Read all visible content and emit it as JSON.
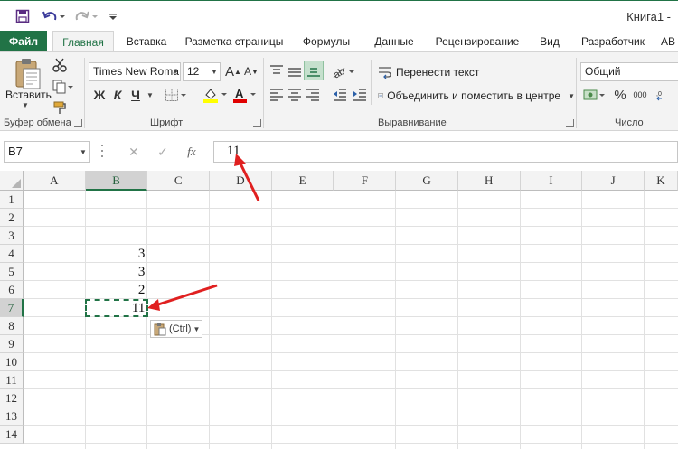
{
  "window": {
    "title": "Книга1 -"
  },
  "tabs": [
    {
      "label": "Файл"
    },
    {
      "label": "Главная"
    },
    {
      "label": "Вставка"
    },
    {
      "label": "Разметка страницы"
    },
    {
      "label": "Формулы"
    },
    {
      "label": "Данные"
    },
    {
      "label": "Рецензирование"
    },
    {
      "label": "Вид"
    },
    {
      "label": "Разработчик"
    },
    {
      "label": "AB"
    }
  ],
  "ribbon": {
    "clipboard": {
      "label": "Буфер обмена",
      "paste_label": "Вставить"
    },
    "font": {
      "label": "Шрифт",
      "name": "Times New Roma",
      "size": "12",
      "bold": "Ж",
      "italic": "К",
      "underline": "Ч",
      "grow": "A",
      "shrink": "A",
      "color_letter": "A",
      "highlight_color": "#ffff00",
      "font_color": "#e00000"
    },
    "alignment": {
      "label": "Выравнивание",
      "wrap_text": "Перенести текст",
      "merge_center": "Объединить и поместить в центре"
    },
    "number": {
      "label": "Число",
      "format": "Общий",
      "percent": "%",
      "thousands": "000"
    }
  },
  "formula_bar": {
    "name_box": "B7",
    "fx_label": "fx",
    "value": "11"
  },
  "grid": {
    "columns": [
      "A",
      "B",
      "C",
      "D",
      "E",
      "F",
      "G",
      "H",
      "I",
      "J",
      "K"
    ],
    "rows": [
      "1",
      "2",
      "3",
      "4",
      "5",
      "6",
      "7",
      "8",
      "9",
      "10",
      "11",
      "12",
      "13",
      "14"
    ],
    "selected_cell": "B7",
    "cells": {
      "B4": "3",
      "B5": "3",
      "B6": "2",
      "B7": "11"
    },
    "paste_options_label": "(Ctrl)"
  },
  "colors": {
    "accent": "#217346",
    "arrow": "#e02020"
  }
}
